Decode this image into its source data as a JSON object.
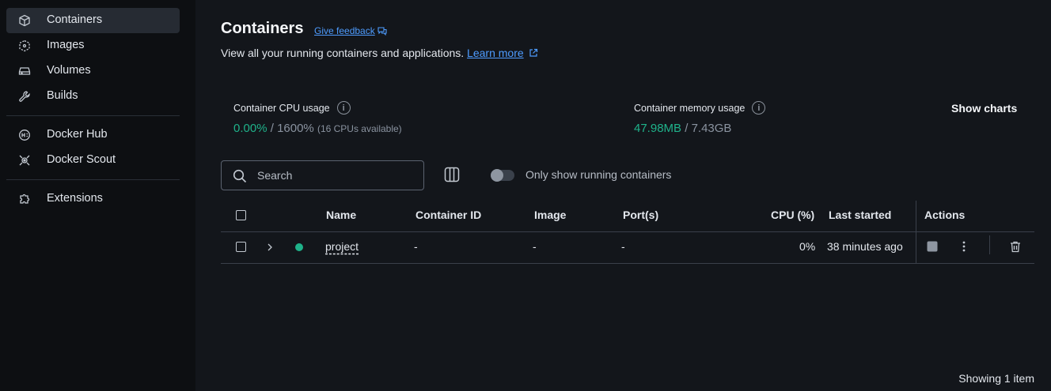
{
  "sidebar": {
    "items": [
      {
        "label": "Containers",
        "icon": "container-icon",
        "active": true
      },
      {
        "label": "Images",
        "icon": "images-icon"
      },
      {
        "label": "Volumes",
        "icon": "volumes-icon"
      },
      {
        "label": "Builds",
        "icon": "wrench-icon"
      },
      {
        "label": "Docker Hub",
        "icon": "hub-icon"
      },
      {
        "label": "Docker Scout",
        "icon": "scout-icon"
      },
      {
        "label": "Extensions",
        "icon": "puzzle-icon"
      }
    ]
  },
  "header": {
    "title": "Containers",
    "feedback_label": "Give feedback",
    "subtitle": "View all your running containers and applications.",
    "learn_more": "Learn more"
  },
  "stats": {
    "cpu": {
      "label": "Container CPU usage",
      "used": "0.00%",
      "sep": " / ",
      "total": "1600%",
      "note": "(16 CPUs available)"
    },
    "memory": {
      "label": "Container memory usage",
      "used": "47.98MB",
      "sep": " / ",
      "total": "7.43GB"
    },
    "show_charts": "Show charts"
  },
  "toolbar": {
    "search_placeholder": "Search",
    "toggle_label": "Only show running containers",
    "toggle_on": false
  },
  "table": {
    "columns": [
      "Name",
      "Container ID",
      "Image",
      "Port(s)",
      "CPU (%)",
      "Last started",
      "Actions"
    ],
    "rows": [
      {
        "name": "project",
        "container_id": "-",
        "image": "-",
        "ports": "-",
        "cpu": "0%",
        "last_started": "38 minutes ago",
        "status": "running"
      }
    ]
  },
  "footer": {
    "showing": "Showing 1 item"
  },
  "colors": {
    "accent_link": "#4e9cff",
    "running_green": "#1fb28a",
    "sidebar_bg": "#0d0f12",
    "main_bg": "#13161b"
  }
}
